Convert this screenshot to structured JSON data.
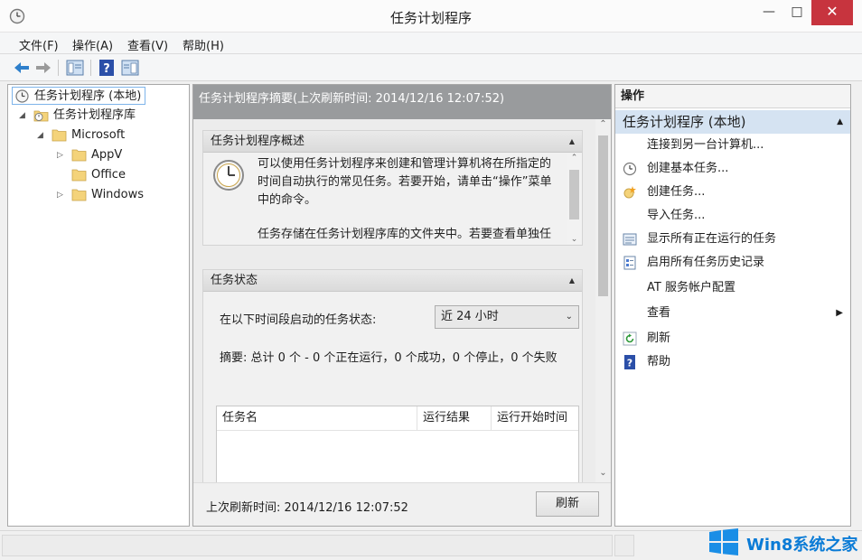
{
  "window": {
    "title": "任务计划程序"
  },
  "menu": [
    "文件(F)",
    "操作(A)",
    "查看(V)",
    "帮助(H)"
  ],
  "tree": {
    "root": "任务计划程序 (本地)",
    "library": "任务计划程序库",
    "microsoft": "Microsoft",
    "appv": "AppV",
    "office": "Office",
    "windows": "Windows"
  },
  "center": {
    "header": "任务计划程序摘要(上次刷新时间: 2014/12/16 12:07:52)",
    "overview": {
      "title": "任务计划程序概述",
      "para1": "可以使用任务计划程序来创建和管理计算机将在所指定的时间自动执行的常见任务。若要开始，请单击“操作”菜单中的命令。",
      "para2": "任务存储在任务计划程序库的文件夹中。若要查看单独任务上的操作或执行该操作，请在任务计划程序库中选"
    },
    "status": {
      "title": "任务状态",
      "period_label": "在以下时间段启动的任务状态:",
      "period_value": "近 24 小时",
      "summary": "摘要: 总计 0 个 - 0 个正在运行，0 个成功，0 个停止，0 个失败",
      "columns": [
        "任务名",
        "运行结果",
        "运行开始时间"
      ]
    },
    "footer": {
      "last_refresh": "上次刷新时间: 2014/12/16 12:07:52",
      "refresh_button": "刷新"
    }
  },
  "actions": {
    "header": "操作",
    "group": "任务计划程序 (本地)",
    "items": [
      "连接到另一台计算机...",
      "创建基本任务...",
      "创建任务...",
      "导入任务...",
      "显示所有正在运行的任务",
      "启用所有任务历史记录",
      "AT 服务帐户配置",
      "查看",
      "刷新",
      "帮助"
    ]
  },
  "watermark": {
    "text": "Win8系统之家"
  },
  "colors": {
    "close": "#c7343e",
    "header_gray": "#999b9d",
    "action_group": "#d5e3f2",
    "accent": "#0a7bd6"
  }
}
